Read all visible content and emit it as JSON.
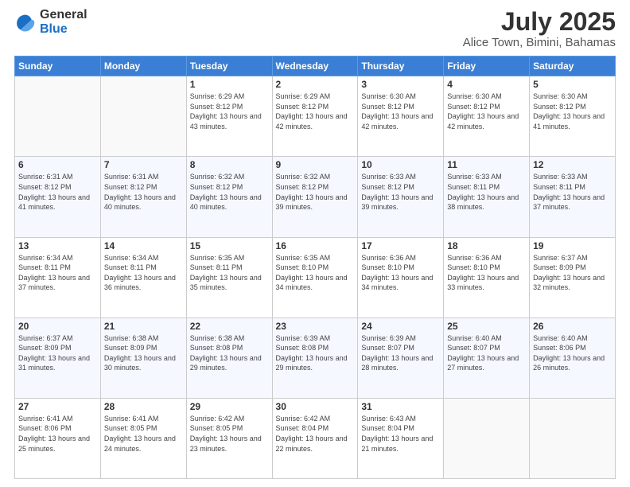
{
  "header": {
    "logo": {
      "general": "General",
      "blue": "Blue"
    },
    "title": "July 2025",
    "subtitle": "Alice Town, Bimini, Bahamas"
  },
  "calendar": {
    "days_of_week": [
      "Sunday",
      "Monday",
      "Tuesday",
      "Wednesday",
      "Thursday",
      "Friday",
      "Saturday"
    ],
    "weeks": [
      [
        {
          "day": "",
          "info": ""
        },
        {
          "day": "",
          "info": ""
        },
        {
          "day": "1",
          "info": "Sunrise: 6:29 AM\nSunset: 8:12 PM\nDaylight: 13 hours and 43 minutes."
        },
        {
          "day": "2",
          "info": "Sunrise: 6:29 AM\nSunset: 8:12 PM\nDaylight: 13 hours and 42 minutes."
        },
        {
          "day": "3",
          "info": "Sunrise: 6:30 AM\nSunset: 8:12 PM\nDaylight: 13 hours and 42 minutes."
        },
        {
          "day": "4",
          "info": "Sunrise: 6:30 AM\nSunset: 8:12 PM\nDaylight: 13 hours and 42 minutes."
        },
        {
          "day": "5",
          "info": "Sunrise: 6:30 AM\nSunset: 8:12 PM\nDaylight: 13 hours and 41 minutes."
        }
      ],
      [
        {
          "day": "6",
          "info": "Sunrise: 6:31 AM\nSunset: 8:12 PM\nDaylight: 13 hours and 41 minutes."
        },
        {
          "day": "7",
          "info": "Sunrise: 6:31 AM\nSunset: 8:12 PM\nDaylight: 13 hours and 40 minutes."
        },
        {
          "day": "8",
          "info": "Sunrise: 6:32 AM\nSunset: 8:12 PM\nDaylight: 13 hours and 40 minutes."
        },
        {
          "day": "9",
          "info": "Sunrise: 6:32 AM\nSunset: 8:12 PM\nDaylight: 13 hours and 39 minutes."
        },
        {
          "day": "10",
          "info": "Sunrise: 6:33 AM\nSunset: 8:12 PM\nDaylight: 13 hours and 39 minutes."
        },
        {
          "day": "11",
          "info": "Sunrise: 6:33 AM\nSunset: 8:11 PM\nDaylight: 13 hours and 38 minutes."
        },
        {
          "day": "12",
          "info": "Sunrise: 6:33 AM\nSunset: 8:11 PM\nDaylight: 13 hours and 37 minutes."
        }
      ],
      [
        {
          "day": "13",
          "info": "Sunrise: 6:34 AM\nSunset: 8:11 PM\nDaylight: 13 hours and 37 minutes."
        },
        {
          "day": "14",
          "info": "Sunrise: 6:34 AM\nSunset: 8:11 PM\nDaylight: 13 hours and 36 minutes."
        },
        {
          "day": "15",
          "info": "Sunrise: 6:35 AM\nSunset: 8:11 PM\nDaylight: 13 hours and 35 minutes."
        },
        {
          "day": "16",
          "info": "Sunrise: 6:35 AM\nSunset: 8:10 PM\nDaylight: 13 hours and 34 minutes."
        },
        {
          "day": "17",
          "info": "Sunrise: 6:36 AM\nSunset: 8:10 PM\nDaylight: 13 hours and 34 minutes."
        },
        {
          "day": "18",
          "info": "Sunrise: 6:36 AM\nSunset: 8:10 PM\nDaylight: 13 hours and 33 minutes."
        },
        {
          "day": "19",
          "info": "Sunrise: 6:37 AM\nSunset: 8:09 PM\nDaylight: 13 hours and 32 minutes."
        }
      ],
      [
        {
          "day": "20",
          "info": "Sunrise: 6:37 AM\nSunset: 8:09 PM\nDaylight: 13 hours and 31 minutes."
        },
        {
          "day": "21",
          "info": "Sunrise: 6:38 AM\nSunset: 8:09 PM\nDaylight: 13 hours and 30 minutes."
        },
        {
          "day": "22",
          "info": "Sunrise: 6:38 AM\nSunset: 8:08 PM\nDaylight: 13 hours and 29 minutes."
        },
        {
          "day": "23",
          "info": "Sunrise: 6:39 AM\nSunset: 8:08 PM\nDaylight: 13 hours and 29 minutes."
        },
        {
          "day": "24",
          "info": "Sunrise: 6:39 AM\nSunset: 8:07 PM\nDaylight: 13 hours and 28 minutes."
        },
        {
          "day": "25",
          "info": "Sunrise: 6:40 AM\nSunset: 8:07 PM\nDaylight: 13 hours and 27 minutes."
        },
        {
          "day": "26",
          "info": "Sunrise: 6:40 AM\nSunset: 8:06 PM\nDaylight: 13 hours and 26 minutes."
        }
      ],
      [
        {
          "day": "27",
          "info": "Sunrise: 6:41 AM\nSunset: 8:06 PM\nDaylight: 13 hours and 25 minutes."
        },
        {
          "day": "28",
          "info": "Sunrise: 6:41 AM\nSunset: 8:05 PM\nDaylight: 13 hours and 24 minutes."
        },
        {
          "day": "29",
          "info": "Sunrise: 6:42 AM\nSunset: 8:05 PM\nDaylight: 13 hours and 23 minutes."
        },
        {
          "day": "30",
          "info": "Sunrise: 6:42 AM\nSunset: 8:04 PM\nDaylight: 13 hours and 22 minutes."
        },
        {
          "day": "31",
          "info": "Sunrise: 6:43 AM\nSunset: 8:04 PM\nDaylight: 13 hours and 21 minutes."
        },
        {
          "day": "",
          "info": ""
        },
        {
          "day": "",
          "info": ""
        }
      ]
    ]
  }
}
